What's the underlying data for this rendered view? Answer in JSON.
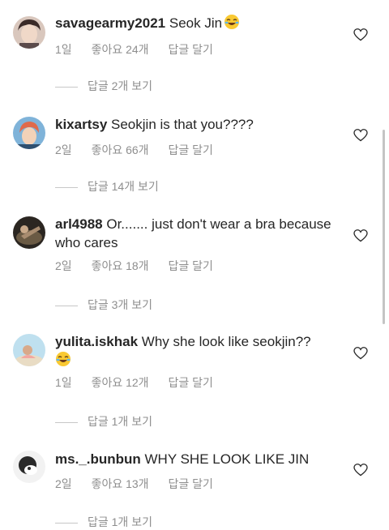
{
  "comments": [
    {
      "username": "savagearmy2021",
      "text": "Seok Jin",
      "emoji": "laughing-emoji",
      "time": "1일",
      "likes": "좋아요 24개",
      "reply": "답글 달기",
      "view_replies": "답글 2개 보기"
    },
    {
      "username": "kixartsy",
      "text": "Seokjin is that you????",
      "time": "2일",
      "likes": "좋아요 66개",
      "reply": "답글 달기",
      "view_replies": "답글 14개 보기"
    },
    {
      "username": "arl4988",
      "text": "Or....... just don't wear a bra because who cares",
      "time": "2일",
      "likes": "좋아요 18개",
      "reply": "답글 달기",
      "view_replies": "답글 3개 보기"
    },
    {
      "username": "yulita.iskhak",
      "text": "Why she look like seokjin??",
      "emoji": "laughing-emoji",
      "time": "1일",
      "likes": "좋아요 12개",
      "reply": "답글 달기",
      "view_replies": "답글 1개 보기"
    },
    {
      "username": "ms._.bunbun",
      "text": "WHY SHE LOOK LIKE JIN",
      "time": "2일",
      "likes": "좋아요 13개",
      "reply": "답글 달기",
      "view_replies": "답글 1개 보기"
    }
  ],
  "colors": {
    "text": "#262626",
    "secondary": "#8e8e8e",
    "divider": "#c7c7c7"
  }
}
